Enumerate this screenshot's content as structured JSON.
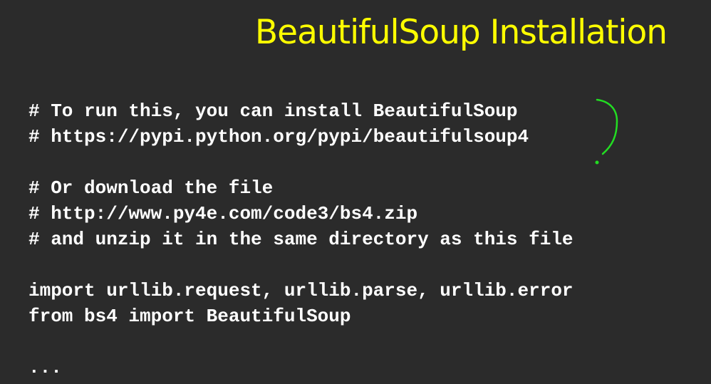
{
  "slide": {
    "title": "BeautifulSoup Installation",
    "code_lines": [
      "# To run this, you can install BeautifulSoup",
      "# https://pypi.python.org/pypi/beautifulsoup4",
      "",
      "# Or download the file",
      "# http://www.py4e.com/code3/bs4.zip",
      "# and unzip it in the same directory as this file",
      "",
      "import urllib.request, urllib.parse, urllib.error",
      "from bs4 import BeautifulSoup",
      "",
      "..."
    ]
  },
  "colors": {
    "background": "#2b2b2b",
    "title": "#ffff00",
    "code": "#ffffff",
    "annotation": "#22dd22"
  }
}
